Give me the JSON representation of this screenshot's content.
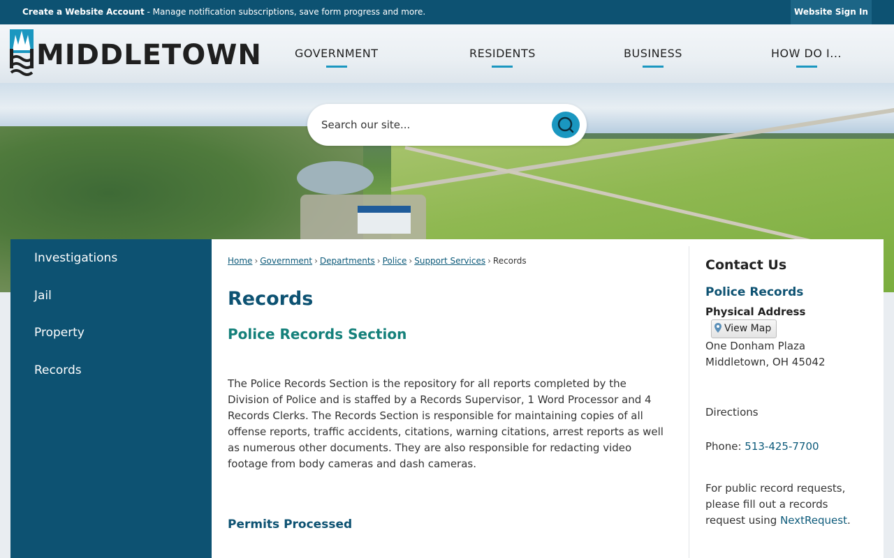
{
  "topbar": {
    "account_link": "Create a Website Account",
    "account_msg": " - Manage notification subscriptions, save form progress and more.",
    "signin": "Website Sign In"
  },
  "logo": {
    "text": "MIDDLETOWN"
  },
  "nav": {
    "items": [
      {
        "label": "GOVERNMENT"
      },
      {
        "label": "RESIDENTS"
      },
      {
        "label": "BUSINESS"
      },
      {
        "label": "HOW DO I..."
      }
    ]
  },
  "search": {
    "placeholder": "Search our site...",
    "icon": "search-icon"
  },
  "sidenav": {
    "items": [
      {
        "label": "Investigations"
      },
      {
        "label": "Jail"
      },
      {
        "label": "Property"
      },
      {
        "label": "Records"
      }
    ]
  },
  "breadcrumb": {
    "items": [
      "Home",
      "Government",
      "Departments",
      "Police",
      "Support Services"
    ],
    "current": "Records",
    "separator": "›"
  },
  "main": {
    "title": "Records",
    "section_title": "Police Records Section",
    "body": "The Police Records Section is the repository for all reports completed by the Division of Police and is staffed by a Records Supervisor, 1 Word Processor and 4 Records Clerks. The Records Section is responsible for maintaining copies of all offense reports, traffic accidents, citations, warning citations, arrest reports as well as numerous other documents. They are also responsible for redacting video footage from body cameras and dash cameras.",
    "sub_title": "Permits Processed"
  },
  "contact": {
    "heading": "Contact Us",
    "name": "Police Records",
    "address_label": "Physical Address",
    "map_button": "View Map",
    "address_line1": "One Donham Plaza",
    "address_line2": "Middletown, OH 45042",
    "directions": "Directions",
    "phone_label": "Phone: ",
    "phone": "513-425-7700",
    "request_text": "For public record requests, please fill out a records request using ",
    "request_link": "NextRequest",
    "request_end": "."
  },
  "colors": {
    "brand_dark": "#0d5272",
    "accent": "#1a97c0",
    "section_teal": "#14807a"
  }
}
